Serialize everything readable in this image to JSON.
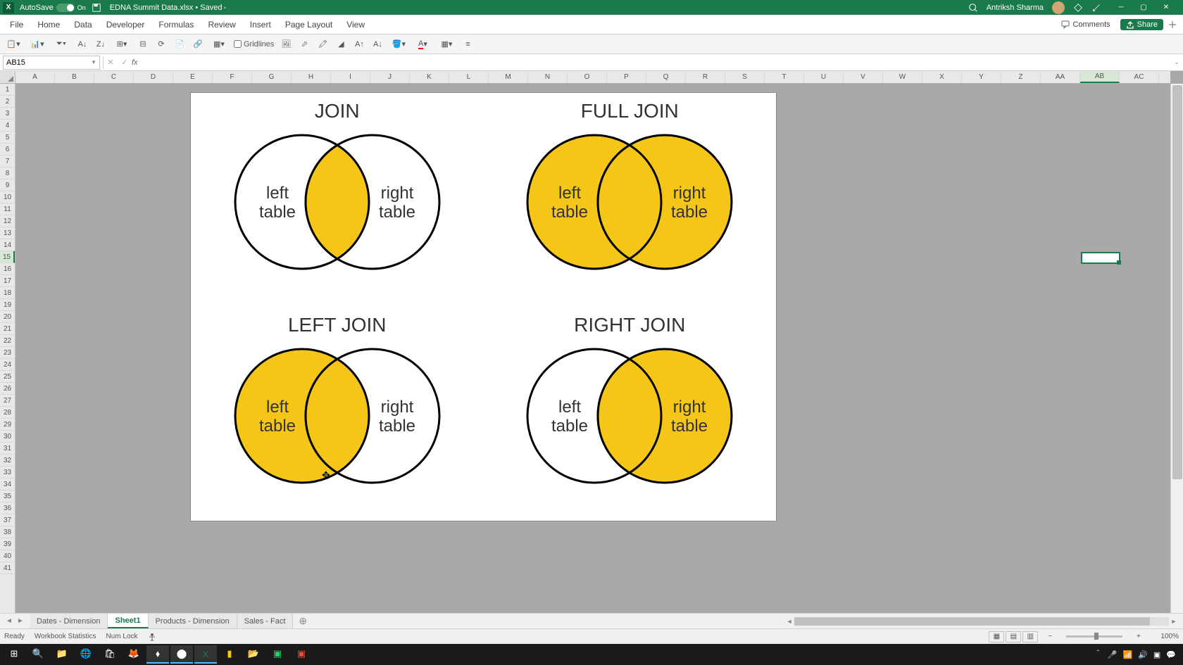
{
  "titleBar": {
    "autoSave": "AutoSave",
    "autoSaveState": "On",
    "docTitle": "EDNA Summit Data.xlsx • Saved ",
    "dirty": "-",
    "user": "Antriksh Sharma"
  },
  "ribbon": {
    "tabs": [
      "File",
      "Home",
      "Data",
      "Developer",
      "Formulas",
      "Review",
      "Insert",
      "Page Layout",
      "View"
    ],
    "activeTab": "",
    "comments": "Comments",
    "share": "Share"
  },
  "toolbar": {
    "gridlines": "Gridlines"
  },
  "formulaBar": {
    "nameBox": "AB15",
    "formula": ""
  },
  "columns": [
    "A",
    "B",
    "C",
    "D",
    "E",
    "F",
    "G",
    "H",
    "I",
    "J",
    "K",
    "L",
    "M",
    "N",
    "O",
    "P",
    "Q",
    "R",
    "S",
    "T",
    "U",
    "V",
    "W",
    "X",
    "Y",
    "Z",
    "AA",
    "AB",
    "AC"
  ],
  "activeColumn": "AB",
  "activeRow": 15,
  "rowCount": 41,
  "venn": {
    "diagrams": [
      {
        "title": "JOIN",
        "left": "left\ntable",
        "right": "right\ntable",
        "fillLeft": false,
        "fillRight": false,
        "fillCenter": true
      },
      {
        "title": "FULL JOIN",
        "left": "left\ntable",
        "right": "right\ntable",
        "fillLeft": true,
        "fillRight": true,
        "fillCenter": true
      },
      {
        "title": "LEFT JOIN",
        "left": "left\ntable",
        "right": "right\ntable",
        "fillLeft": true,
        "fillRight": false,
        "fillCenter": true
      },
      {
        "title": "RIGHT JOIN",
        "left": "left\ntable",
        "right": "right\ntable",
        "fillLeft": false,
        "fillRight": true,
        "fillCenter": true
      }
    ],
    "colors": {
      "fill": "#f5c518",
      "stroke": "#000000"
    }
  },
  "sheetTabs": {
    "tabs": [
      "Dates - Dimension",
      "Sheet1",
      "Products - Dimension",
      "Sales - Fact"
    ],
    "active": "Sheet1"
  },
  "statusBar": {
    "ready": "Ready",
    "stats": "Workbook Statistics",
    "numlock": "Num Lock",
    "zoom": "100%"
  },
  "taskbar": {
    "apps": [
      "windows",
      "search",
      "files",
      "edge",
      "store",
      "firefox",
      "vscode",
      "chrome",
      "excel",
      "powerbi",
      "explorer",
      "whatsapp",
      "app2"
    ]
  }
}
